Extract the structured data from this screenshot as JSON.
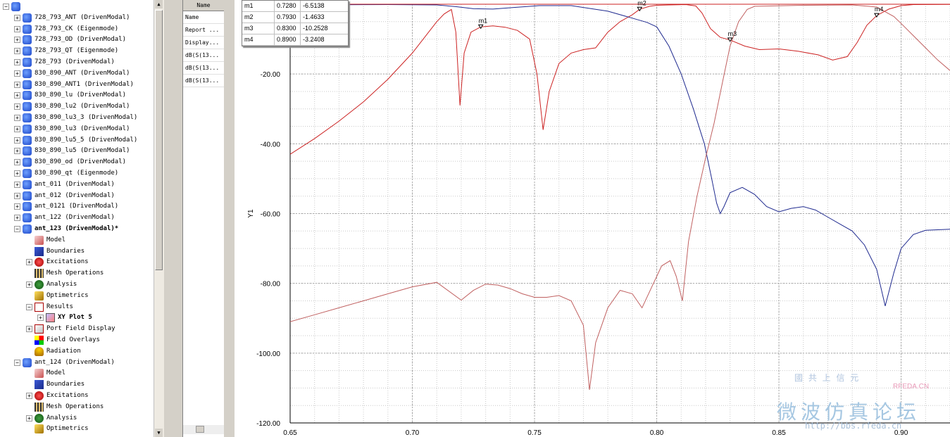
{
  "tree": {
    "items": [
      {
        "label": "",
        "depth": 0,
        "expander": "−",
        "icon": "project-folder-icon",
        "bold": false
      },
      {
        "label": "728_793_ANT (DrivenModal)",
        "depth": 1,
        "expander": "+",
        "icon": "hfss-design-icon"
      },
      {
        "label": "728_793_CK (Eigenmode)",
        "depth": 1,
        "expander": "+",
        "icon": "hfss-design-icon"
      },
      {
        "label": "728_793_OD (DrivenModal)",
        "depth": 1,
        "expander": "+",
        "icon": "hfss-design-icon"
      },
      {
        "label": "728_793_QT (Eigenmode)",
        "depth": 1,
        "expander": "+",
        "icon": "hfss-design-icon"
      },
      {
        "label": "728_793 (DrivenModal)",
        "depth": 1,
        "expander": "+",
        "icon": "hfss-design-icon"
      },
      {
        "label": "830_890_ANT (DrivenModal)",
        "depth": 1,
        "expander": "+",
        "icon": "hfss-design-icon"
      },
      {
        "label": "830_890_ANT1 (DrivenModal)",
        "depth": 1,
        "expander": "+",
        "icon": "hfss-design-icon"
      },
      {
        "label": "830_890_lu (DrivenModal)",
        "depth": 1,
        "expander": "+",
        "icon": "hfss-design-icon"
      },
      {
        "label": "830_890_lu2 (DrivenModal)",
        "depth": 1,
        "expander": "+",
        "icon": "hfss-design-icon"
      },
      {
        "label": "830_890_lu3_3 (DrivenModal)",
        "depth": 1,
        "expander": "+",
        "icon": "hfss-design-icon"
      },
      {
        "label": "830_890_lu3 (DrivenModal)",
        "depth": 1,
        "expander": "+",
        "icon": "hfss-design-icon"
      },
      {
        "label": "830_890_lu5_5 (DrivenModal)",
        "depth": 1,
        "expander": "+",
        "icon": "hfss-design-icon"
      },
      {
        "label": "830_890_lu5 (DrivenModal)",
        "depth": 1,
        "expander": "+",
        "icon": "hfss-design-icon"
      },
      {
        "label": "830_890_od (DrivenModal)",
        "depth": 1,
        "expander": "+",
        "icon": "hfss-design-icon"
      },
      {
        "label": "830_890_qt (Eigenmode)",
        "depth": 1,
        "expander": "+",
        "icon": "hfss-design-icon"
      },
      {
        "label": "ant_011 (DrivenModal)",
        "depth": 1,
        "expander": "+",
        "icon": "hfss-design-icon"
      },
      {
        "label": "ant_012 (DrivenModal)",
        "depth": 1,
        "expander": "+",
        "icon": "hfss-design-icon"
      },
      {
        "label": "ant_0121 (DrivenModal)",
        "depth": 1,
        "expander": "+",
        "icon": "hfss-design-icon"
      },
      {
        "label": "ant_122 (DrivenModal)",
        "depth": 1,
        "expander": "+",
        "icon": "hfss-design-icon"
      },
      {
        "label": "ant_123 (DrivenModal)*",
        "depth": 1,
        "expander": "−",
        "icon": "hfss-design-icon",
        "bold": true
      },
      {
        "label": "Model",
        "depth": 2,
        "expander": "",
        "icon": "model-icon"
      },
      {
        "label": "Boundaries",
        "depth": 2,
        "expander": "",
        "icon": "boundaries-icon"
      },
      {
        "label": "Excitations",
        "depth": 2,
        "expander": "+",
        "icon": "excitations-icon"
      },
      {
        "label": "Mesh Operations",
        "depth": 2,
        "expander": "",
        "icon": "mesh-operations-icon"
      },
      {
        "label": "Analysis",
        "depth": 2,
        "expander": "+",
        "icon": "analysis-icon"
      },
      {
        "label": "Optimetrics",
        "depth": 2,
        "expander": "",
        "icon": "optimetrics-icon"
      },
      {
        "label": "Results",
        "depth": 2,
        "expander": "−",
        "icon": "results-icon"
      },
      {
        "label": "XY Plot 5",
        "depth": 3,
        "expander": "+",
        "icon": "xy-plot-icon",
        "bold": true
      },
      {
        "label": "Port Field Display",
        "depth": 2,
        "expander": "+",
        "icon": "port-field-icon"
      },
      {
        "label": "Field Overlays",
        "depth": 2,
        "expander": "",
        "icon": "field-overlays-icon"
      },
      {
        "label": "Radiation",
        "depth": 2,
        "expander": "",
        "icon": "radiation-icon"
      },
      {
        "label": "ant_124 (DrivenModal)",
        "depth": 1,
        "expander": "−",
        "icon": "hfss-design-icon"
      },
      {
        "label": "Model",
        "depth": 2,
        "expander": "",
        "icon": "model-icon"
      },
      {
        "label": "Boundaries",
        "depth": 2,
        "expander": "",
        "icon": "boundaries-icon"
      },
      {
        "label": "Excitations",
        "depth": 2,
        "expander": "+",
        "icon": "excitations-icon"
      },
      {
        "label": "Mesh Operations",
        "depth": 2,
        "expander": "",
        "icon": "mesh-operations-icon"
      },
      {
        "label": "Analysis",
        "depth": 2,
        "expander": "+",
        "icon": "analysis-icon"
      },
      {
        "label": "Optimetrics",
        "depth": 2,
        "expander": "",
        "icon": "optimetrics-icon"
      }
    ]
  },
  "properties": {
    "header": "Name",
    "rows": [
      "Name",
      "Report ...",
      "Display...",
      "dB(S(13...",
      "dB(S(13...",
      "dB(S(13..."
    ]
  },
  "markers": [
    {
      "name": "m1",
      "x": "0.7280",
      "y": "-6.5138"
    },
    {
      "name": "m2",
      "x": "0.7930",
      "y": "-1.4633"
    },
    {
      "name": "m3",
      "x": "0.8300",
      "y": "-10.2528"
    },
    {
      "name": "m4",
      "x": "0.8900",
      "y": "-3.2408"
    }
  ],
  "chart_data": {
    "type": "line",
    "ylabel": "Y1",
    "xlabel": "",
    "xlim": [
      0.65,
      0.92
    ],
    "ylim": [
      -120,
      0
    ],
    "x_ticks": [
      "0.65",
      "0.70",
      "0.75",
      "0.80",
      "0.85",
      "0.90"
    ],
    "y_ticks": [
      "-20.00",
      "-40.00",
      "-60.00",
      "-80.00",
      "-100.00",
      "-120.00"
    ],
    "grid": true,
    "colors": {
      "series1": "#cc2222",
      "series2": "#1f2a8f",
      "series3": "#c06060"
    },
    "series": [
      {
        "points": [
          [
            0.65,
            -43
          ],
          [
            0.66,
            -38.5
          ],
          [
            0.67,
            -33.5
          ],
          [
            0.68,
            -28
          ],
          [
            0.69,
            -21.5
          ],
          [
            0.7,
            -14
          ],
          [
            0.705,
            -9.5
          ],
          [
            0.71,
            -5
          ],
          [
            0.713,
            -2.8
          ],
          [
            0.716,
            -1.5
          ],
          [
            0.7178,
            -8
          ],
          [
            0.7195,
            -29
          ],
          [
            0.7212,
            -14
          ],
          [
            0.724,
            -8
          ],
          [
            0.728,
            -6.5
          ],
          [
            0.733,
            -6.2
          ],
          [
            0.738,
            -6.6
          ],
          [
            0.743,
            -7.5
          ],
          [
            0.748,
            -10
          ],
          [
            0.751,
            -20
          ],
          [
            0.7535,
            -36
          ],
          [
            0.756,
            -25
          ],
          [
            0.76,
            -17
          ],
          [
            0.765,
            -14
          ],
          [
            0.77,
            -13
          ],
          [
            0.775,
            -12.5
          ],
          [
            0.78,
            -8
          ],
          [
            0.785,
            -5
          ],
          [
            0.79,
            -3
          ],
          [
            0.793,
            -1.46
          ],
          [
            0.797,
            -0.6
          ],
          [
            0.8,
            -0.3
          ],
          [
            0.805,
            -0.2
          ],
          [
            0.812,
            -0.1
          ],
          [
            0.816,
            -0.5
          ],
          [
            0.8185,
            -2.5
          ],
          [
            0.822,
            -7
          ],
          [
            0.826,
            -9.5
          ],
          [
            0.83,
            -10.25
          ],
          [
            0.836,
            -12
          ],
          [
            0.842,
            -13
          ],
          [
            0.85,
            -12.8
          ],
          [
            0.858,
            -13.5
          ],
          [
            0.866,
            -14.5
          ],
          [
            0.872,
            -16
          ],
          [
            0.878,
            -15
          ],
          [
            0.882,
            -11
          ],
          [
            0.886,
            -6
          ],
          [
            0.89,
            -3.24
          ],
          [
            0.895,
            -1.4
          ],
          [
            0.9,
            -0.4
          ],
          [
            0.905,
            -0.1
          ],
          [
            0.92,
            -0.05
          ]
        ]
      },
      {
        "points": [
          [
            0.65,
            -0.2
          ],
          [
            0.69,
            -0.1
          ],
          [
            0.71,
            -0.2
          ],
          [
            0.718,
            -0.7
          ],
          [
            0.725,
            -1.3
          ],
          [
            0.733,
            -1.4
          ],
          [
            0.742,
            -0.9
          ],
          [
            0.752,
            -0.4
          ],
          [
            0.765,
            -0.4
          ],
          [
            0.78,
            -2
          ],
          [
            0.79,
            -4
          ],
          [
            0.796,
            -5.2
          ],
          [
            0.8,
            -6.5
          ],
          [
            0.805,
            -12
          ],
          [
            0.81,
            -20
          ],
          [
            0.815,
            -30
          ],
          [
            0.8195,
            -40
          ],
          [
            0.8225,
            -50
          ],
          [
            0.8245,
            -57
          ],
          [
            0.826,
            -60
          ],
          [
            0.8275,
            -58
          ],
          [
            0.83,
            -54
          ],
          [
            0.835,
            -52.5
          ],
          [
            0.84,
            -54.5
          ],
          [
            0.845,
            -58
          ],
          [
            0.85,
            -59.5
          ],
          [
            0.855,
            -58.5
          ],
          [
            0.86,
            -58
          ],
          [
            0.865,
            -59
          ],
          [
            0.87,
            -61
          ],
          [
            0.875,
            -63
          ],
          [
            0.88,
            -65
          ],
          [
            0.885,
            -69
          ],
          [
            0.89,
            -76
          ],
          [
            0.8935,
            -86.5
          ],
          [
            0.897,
            -77
          ],
          [
            0.9,
            -70
          ],
          [
            0.905,
            -66
          ],
          [
            0.91,
            -64.8
          ],
          [
            0.92,
            -64.5
          ]
        ]
      },
      {
        "points": [
          [
            0.65,
            -91
          ],
          [
            0.66,
            -89
          ],
          [
            0.67,
            -87
          ],
          [
            0.68,
            -85
          ],
          [
            0.69,
            -83
          ],
          [
            0.7,
            -81
          ],
          [
            0.71,
            -79.7
          ],
          [
            0.72,
            -84.8
          ],
          [
            0.725,
            -82
          ],
          [
            0.73,
            -80.2
          ],
          [
            0.735,
            -80.5
          ],
          [
            0.74,
            -81.5
          ],
          [
            0.745,
            -83
          ],
          [
            0.75,
            -84
          ],
          [
            0.755,
            -84
          ],
          [
            0.76,
            -83.5
          ],
          [
            0.765,
            -85
          ],
          [
            0.77,
            -92
          ],
          [
            0.7725,
            -110.5
          ],
          [
            0.775,
            -97
          ],
          [
            0.78,
            -87
          ],
          [
            0.785,
            -82
          ],
          [
            0.79,
            -83
          ],
          [
            0.794,
            -87
          ],
          [
            0.798,
            -81
          ],
          [
            0.802,
            -75
          ],
          [
            0.8055,
            -73.5
          ],
          [
            0.808,
            -78
          ],
          [
            0.8105,
            -85
          ],
          [
            0.813,
            -68
          ],
          [
            0.8165,
            -55
          ],
          [
            0.82,
            -44
          ],
          [
            0.8235,
            -34
          ],
          [
            0.827,
            -22
          ],
          [
            0.83,
            -12
          ],
          [
            0.8335,
            -5
          ],
          [
            0.837,
            -1.5
          ],
          [
            0.84,
            -0.6
          ],
          [
            0.86,
            -0.3
          ],
          [
            0.88,
            -0.2
          ],
          [
            0.89,
            -0.8
          ],
          [
            0.897,
            -3.5
          ],
          [
            0.9,
            -5.5
          ],
          [
            0.905,
            -9
          ],
          [
            0.91,
            -12.5
          ],
          [
            0.915,
            -16
          ],
          [
            0.92,
            -19
          ]
        ]
      }
    ],
    "marker_labels": [
      {
        "name": "m1",
        "x": 0.728,
        "y": -6.5138
      },
      {
        "name": "m2",
        "x": 0.793,
        "y": -1.4633
      },
      {
        "name": "m3",
        "x": 0.83,
        "y": -10.2528
      },
      {
        "name": "m4",
        "x": 0.89,
        "y": -3.2408
      }
    ]
  },
  "watermark": {
    "sub": "國 共 上 信 元",
    "brand": "RFEDA.CN",
    "main": "微波仿真论坛",
    "url": "http://bbs.rfeda.cn"
  }
}
